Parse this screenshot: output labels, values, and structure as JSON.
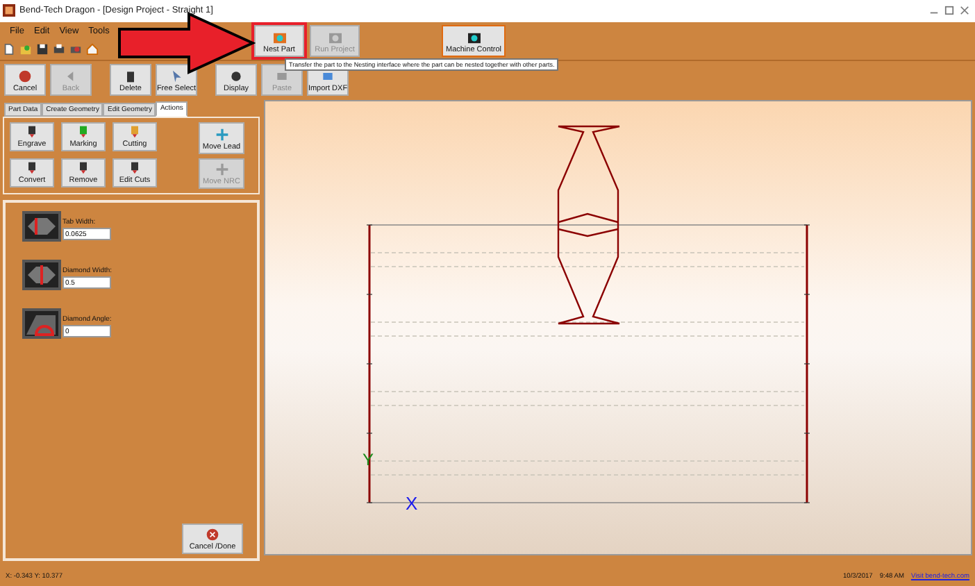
{
  "window": {
    "title": "Bend-Tech Dragon - [Design Project - Straight 1]"
  },
  "menu": [
    "File",
    "Edit",
    "View",
    "Tools"
  ],
  "top_buttons": [
    {
      "label": "Nest Part",
      "disabled": false,
      "highlighted": true
    },
    {
      "label": "Run Project",
      "disabled": true,
      "highlighted": false
    },
    {
      "label": "Machine Control",
      "disabled": false,
      "highlighted": false
    }
  ],
  "tooltip": "Transfer the part to the Nesting interface where the part can be nested together with other parts.",
  "toolbar": [
    {
      "label": "Cancel",
      "disabled": false
    },
    {
      "label": "Back",
      "disabled": true
    },
    {
      "label": "Delete",
      "disabled": false
    },
    {
      "label": "Free Select",
      "disabled": false
    },
    {
      "label": "Display",
      "disabled": false
    },
    {
      "label": "Paste",
      "disabled": true
    },
    {
      "label": "Import DXF",
      "disabled": false
    }
  ],
  "tabs": [
    {
      "label": "Part Data",
      "selected": false
    },
    {
      "label": "Create Geometry",
      "selected": false
    },
    {
      "label": "Edit Geometry",
      "selected": false
    },
    {
      "label": "Actions",
      "selected": true
    }
  ],
  "actions": [
    {
      "label": "Engrave",
      "disabled": false
    },
    {
      "label": "Marking",
      "disabled": false
    },
    {
      "label": "Cutting",
      "disabled": false
    },
    {
      "label": "Convert",
      "disabled": false
    },
    {
      "label": "Remove",
      "disabled": false
    },
    {
      "label": "Edit Cuts",
      "disabled": false
    }
  ],
  "move_buttons": [
    {
      "label": "Move Lead",
      "disabled": false
    },
    {
      "label": "Move NRC",
      "disabled": true
    }
  ],
  "fields": [
    {
      "label": "Tab Width:",
      "value": "0.0625"
    },
    {
      "label": "Diamond Width:",
      "value": "0.5"
    },
    {
      "label": "Diamond Angle:",
      "value": "0"
    }
  ],
  "done_button": "Cancel /Done",
  "canvas": {
    "y_axis": "Y",
    "x_axis": "X"
  },
  "status_bar": {
    "coords": "X: -0.343  Y: 10.377",
    "date": "10/3/2017",
    "time": "9:48 AM",
    "link": "Visit bend-tech.com"
  }
}
